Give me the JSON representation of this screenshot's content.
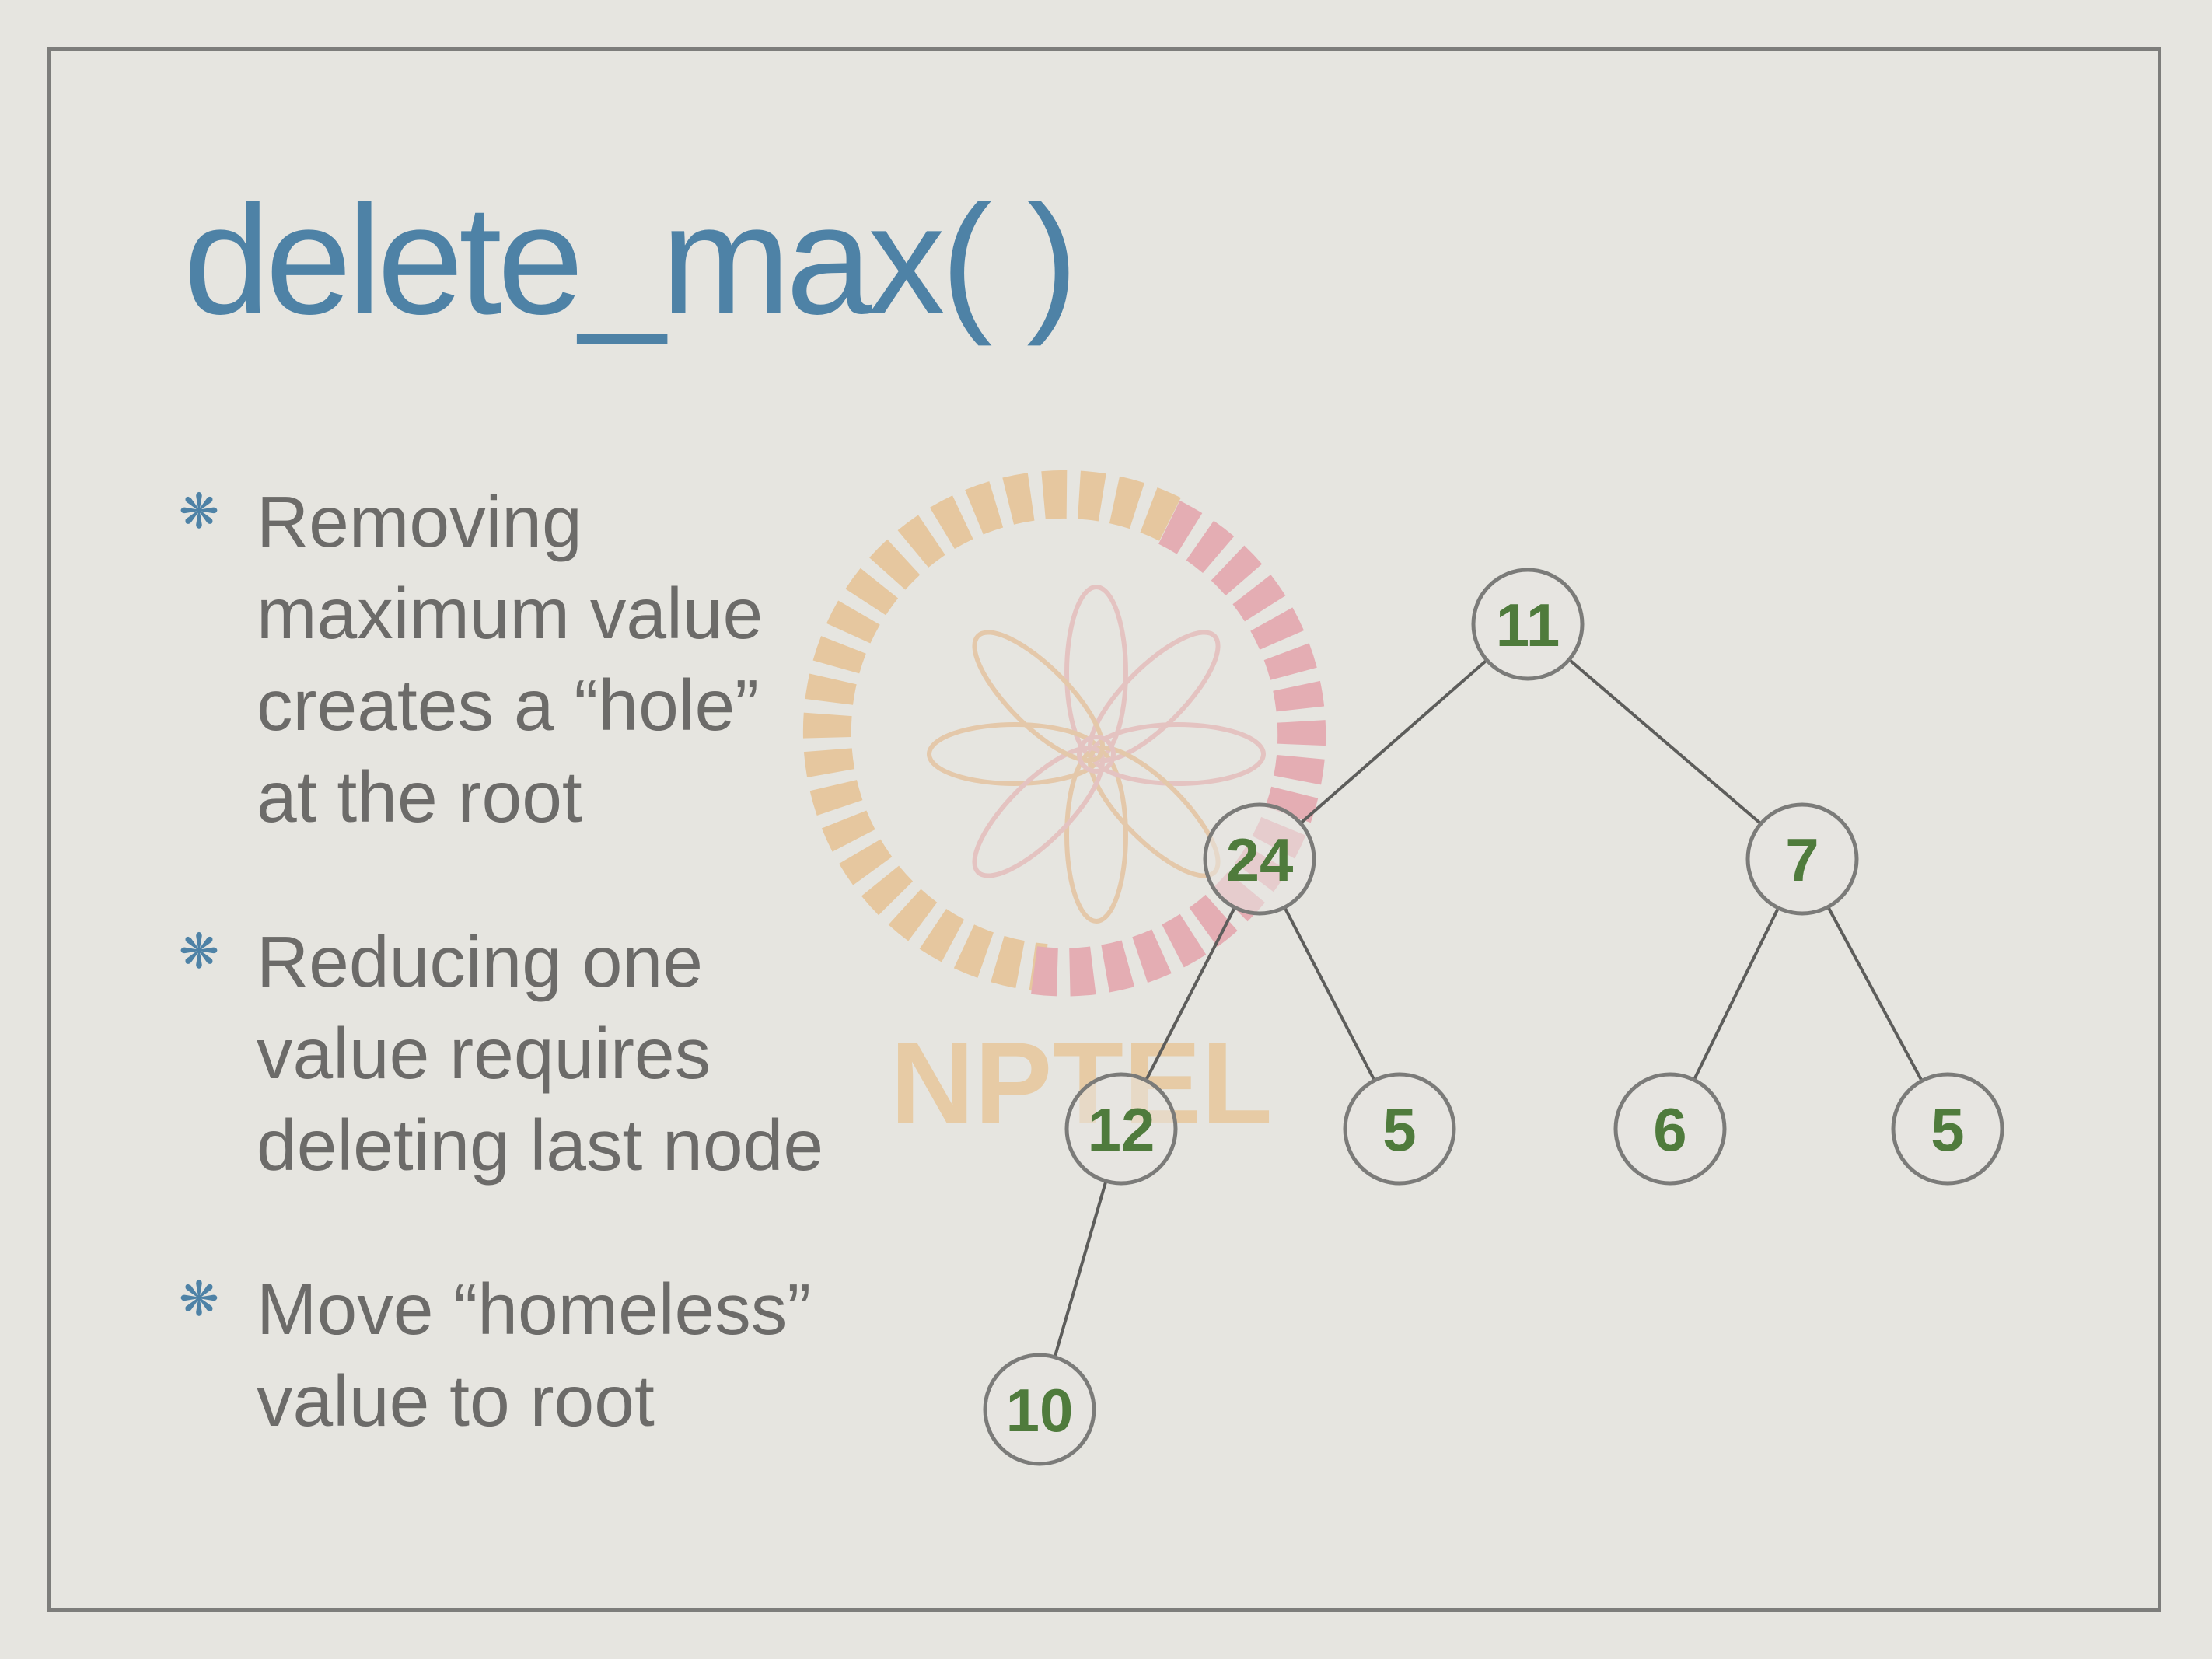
{
  "slide": {
    "title": "delete_max( )",
    "bullet_marker": "❋",
    "bullets": [
      {
        "text": "Removing\nmaximum value\ncreates a “hole”\nat the root"
      },
      {
        "text": "Reducing one\nvalue requires\ndeleting last node"
      },
      {
        "text": "Move “homeless”\nvalue to root"
      }
    ]
  },
  "watermark": {
    "text": "NPTEL",
    "colors": {
      "orange": "#e8b775",
      "pink": "#e58c9a"
    }
  },
  "colors": {
    "title": "#4e82a6",
    "body_text": "#6c6b69",
    "node_label": "#4f7b3c",
    "frame": "#7d7d7b",
    "background": "#e6e5e0"
  },
  "tree": {
    "nodes": [
      {
        "id": "root",
        "value": "11"
      },
      {
        "id": "left",
        "value": "24"
      },
      {
        "id": "right",
        "value": "7"
      },
      {
        "id": "left-left",
        "value": "12"
      },
      {
        "id": "left-right",
        "value": "5"
      },
      {
        "id": "right-left",
        "value": "6"
      },
      {
        "id": "right-right",
        "value": "5"
      },
      {
        "id": "left-left-left",
        "value": "10"
      }
    ],
    "edges": [
      {
        "from": "root",
        "to": "left"
      },
      {
        "from": "root",
        "to": "right"
      },
      {
        "from": "left",
        "to": "left-left"
      },
      {
        "from": "left",
        "to": "left-right"
      },
      {
        "from": "right",
        "to": "right-left"
      },
      {
        "from": "right",
        "to": "right-right"
      },
      {
        "from": "left-left",
        "to": "left-left-left"
      }
    ]
  }
}
